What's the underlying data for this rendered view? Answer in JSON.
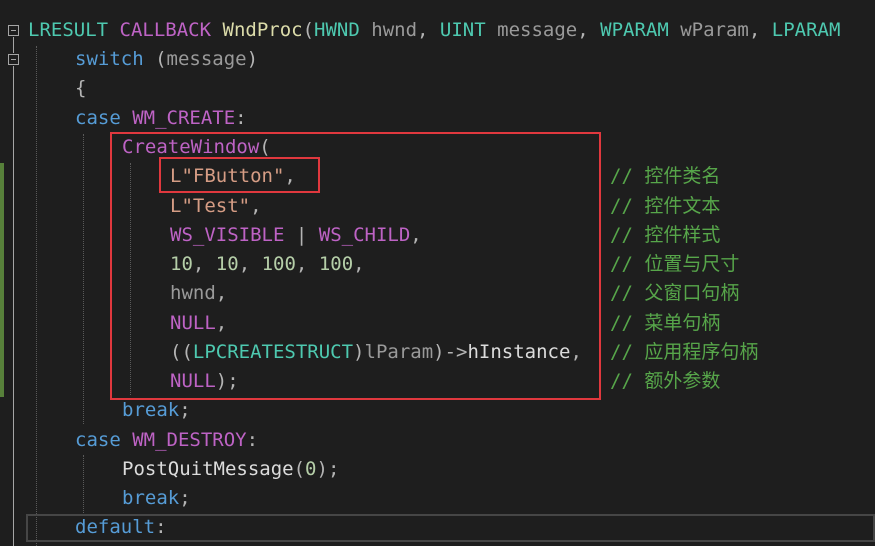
{
  "code": {
    "line1": {
      "ret_type": "LRESULT",
      "callconv": "CALLBACK",
      "fn_name": "WndProc",
      "open": "(",
      "t1": "HWND",
      "p1": "hwnd",
      "sep1": ",",
      "t2": "UINT",
      "p2": "message",
      "sep2": ",",
      "t3": "WPARAM",
      "p3": "wParam",
      "sep3": ",",
      "t4": "LPARAM"
    },
    "line2": {
      "kw": "switch",
      "open": "(",
      "arg": "message",
      "close": ")"
    },
    "line3": {
      "brace": "{"
    },
    "line4": {
      "kw": "case",
      "macro": "WM_CREATE",
      "colon": ":"
    },
    "line5": {
      "fn": "CreateWindow",
      "open": "("
    },
    "line6": {
      "str": "L\"FButton\"",
      "comma": ","
    },
    "line7": {
      "str": "L\"Test\"",
      "comma": ","
    },
    "line8": {
      "m1": "WS_VISIBLE",
      "op": "|",
      "m2": "WS_CHILD",
      "comma": ","
    },
    "line9": {
      "n1": "10",
      "n2": "10",
      "n3": "100",
      "n4": "100",
      "sep": ",",
      "trail": ","
    },
    "line10": {
      "param": "hwnd",
      "comma": ","
    },
    "line11": {
      "macro": "NULL",
      "comma": ","
    },
    "line12": {
      "open": "((",
      "type": "LPCREATESTRUCT",
      "close1": ")",
      "param": "lParam",
      "close2": ")",
      "arrow": "->",
      "member": "hInstance",
      "comma": ","
    },
    "line13": {
      "macro": "NULL",
      "close": ");"
    },
    "line14": {
      "kw": "break",
      "semi": ";"
    },
    "line15": {
      "kw": "case",
      "macro": "WM_DESTROY",
      "colon": ":"
    },
    "line16": {
      "fn": "PostQuitMessage",
      "open": "(",
      "num": "0",
      "close": ");"
    },
    "line17": {
      "kw": "break",
      "semi": ";"
    },
    "line18": {
      "kw": "default",
      "colon": ":"
    }
  },
  "comments": [
    "// 控件类名",
    "// 控件文本",
    "// 控件样式",
    "// 位置与尺寸",
    "// 父窗口句柄",
    "// 菜单句柄",
    "// 应用程序句柄",
    "// 额外参数"
  ],
  "colors": {
    "background": "#1e1e1e",
    "keyword": "#569cd6",
    "macro": "#be63c5",
    "type": "#4ec9b0",
    "function": "#dcdcaa",
    "string": "#d69d85",
    "number": "#b5cea8",
    "comment": "#57a64a",
    "highlight_box": "#e0383e"
  }
}
